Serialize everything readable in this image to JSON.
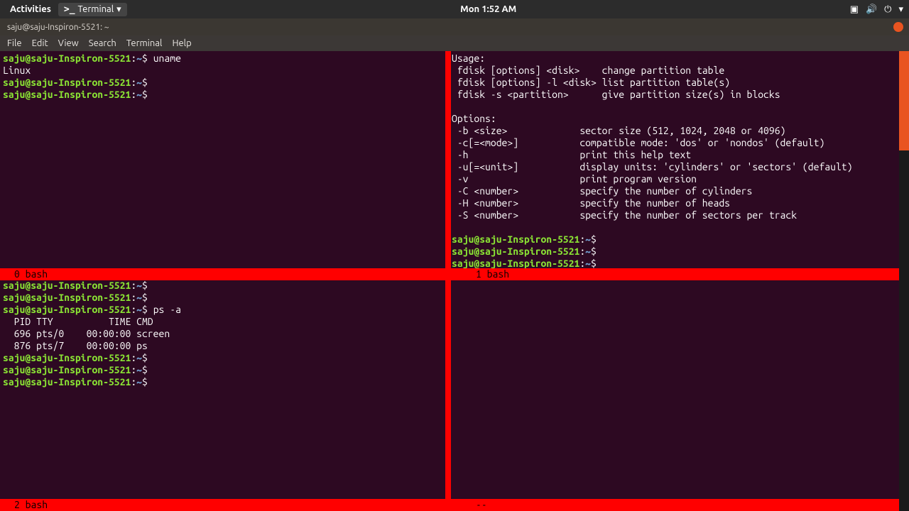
{
  "topbar": {
    "activities": "Activities",
    "app_name": "Terminal",
    "datetime": "Mon  1:52 AM"
  },
  "window": {
    "title": "saju@saju-Inspiron-5521: ~"
  },
  "menubar": {
    "file": "File",
    "edit": "Edit",
    "view": "View",
    "search": "Search",
    "terminal": "Terminal",
    "help": "Help"
  },
  "prompt": {
    "user_host": "saju@saju-Inspiron-5521",
    "sep": ":",
    "path": "~",
    "sigil": "$"
  },
  "panes": {
    "tl": {
      "cmd1": "uname",
      "out1": "Linux"
    },
    "tr": {
      "l1": "Usage:",
      "l2": " fdisk [options] <disk>    change partition table",
      "l3": " fdisk [options] -l <disk> list partition table(s)",
      "l4": " fdisk -s <partition>      give partition size(s) in blocks",
      "l5": "Options:",
      "l6": " -b <size>             sector size (512, 1024, 2048 or 4096)",
      "l7": " -c[=<mode>]           compatible mode: 'dos' or 'nondos' (default)",
      "l8": " -h                    print this help text",
      "l9": " -u[=<unit>]           display units: 'cylinders' or 'sectors' (default)",
      "l10": " -v                    print program version",
      "l11": " -C <number>           specify the number of cylinders",
      "l12": " -H <number>           specify the number of heads",
      "l13": " -S <number>           specify the number of sectors per track"
    },
    "bl": {
      "cmd1": "ps -a",
      "h1": "  PID TTY          TIME CMD",
      "r1": "  696 pts/0    00:00:00 screen",
      "r2": "  876 pts/7    00:00:00 ps"
    }
  },
  "tabs": {
    "mid_left": "0 bash",
    "mid_right": "1 bash",
    "bot_left": "2 bash",
    "bot_right": "--"
  }
}
